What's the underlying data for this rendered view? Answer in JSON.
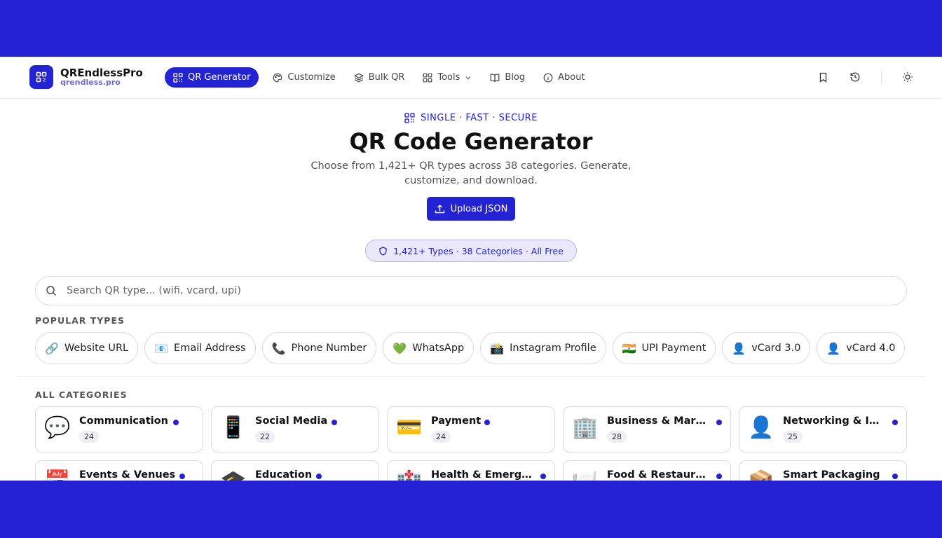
{
  "brand": {
    "name": "QREndlessPro",
    "domain": "qrendless.pro"
  },
  "nav": {
    "items": [
      {
        "label": "QR Generator",
        "icon": "qr-icon",
        "active": true
      },
      {
        "label": "Customize",
        "icon": "palette-icon"
      },
      {
        "label": "Bulk QR",
        "icon": "layers-icon"
      },
      {
        "label": "Tools",
        "icon": "grid-icon",
        "dropdown": true
      },
      {
        "label": "Blog",
        "icon": "book-icon"
      },
      {
        "label": "About",
        "icon": "info-icon"
      }
    ],
    "right_icons": [
      "bookmark-icon",
      "history-icon",
      "theme-sun-icon"
    ]
  },
  "hero": {
    "eyebrow": "SINGLE · FAST · SECURE",
    "title": "QR Code Generator",
    "subtitle": "Choose from 1,421+ QR types across 38 categories. Generate, customize, and download.",
    "upload_label": "Upload JSON",
    "stats": "1,421+ Types · 38 Categories · All Free"
  },
  "search": {
    "placeholder": "Search QR type... (wifi, vcard, upi)",
    "value": ""
  },
  "popular": {
    "heading": "POPULAR TYPES",
    "items": [
      {
        "emoji": "🔗",
        "label": "Website URL"
      },
      {
        "emoji": "📧",
        "label": "Email Address"
      },
      {
        "emoji": "📞",
        "label": "Phone Number"
      },
      {
        "emoji": "💚",
        "label": "WhatsApp"
      },
      {
        "emoji": "📸",
        "label": "Instagram Profile"
      },
      {
        "emoji": "🇮🇳",
        "label": "UPI Payment"
      },
      {
        "emoji": "👤",
        "label": "vCard 3.0"
      },
      {
        "emoji": "👤",
        "label": "vCard 4.0"
      }
    ]
  },
  "categories": {
    "heading": "ALL CATEGORIES",
    "items": [
      {
        "emoji": "💬",
        "name": "Communication",
        "count": "24"
      },
      {
        "emoji": "📱",
        "name": "Social Media",
        "count": "22"
      },
      {
        "emoji": "💳",
        "name": "Payment",
        "count": "24"
      },
      {
        "emoji": "🏢",
        "name": "Business & Marketing",
        "count": "28"
      },
      {
        "emoji": "👤",
        "name": "Networking & Identity",
        "count": "25"
      },
      {
        "emoji": "📅",
        "name": "Events & Venues",
        "count": ""
      },
      {
        "emoji": "🎓",
        "name": "Education",
        "count": ""
      },
      {
        "emoji": "🏥",
        "name": "Health & Emergency",
        "count": ""
      },
      {
        "emoji": "🍽️",
        "name": "Food & Restaurant",
        "count": ""
      },
      {
        "emoji": "📦",
        "name": "Smart Packaging",
        "count": ""
      }
    ]
  },
  "colors": {
    "accent": "#2323d4",
    "background": "#ffffff"
  }
}
